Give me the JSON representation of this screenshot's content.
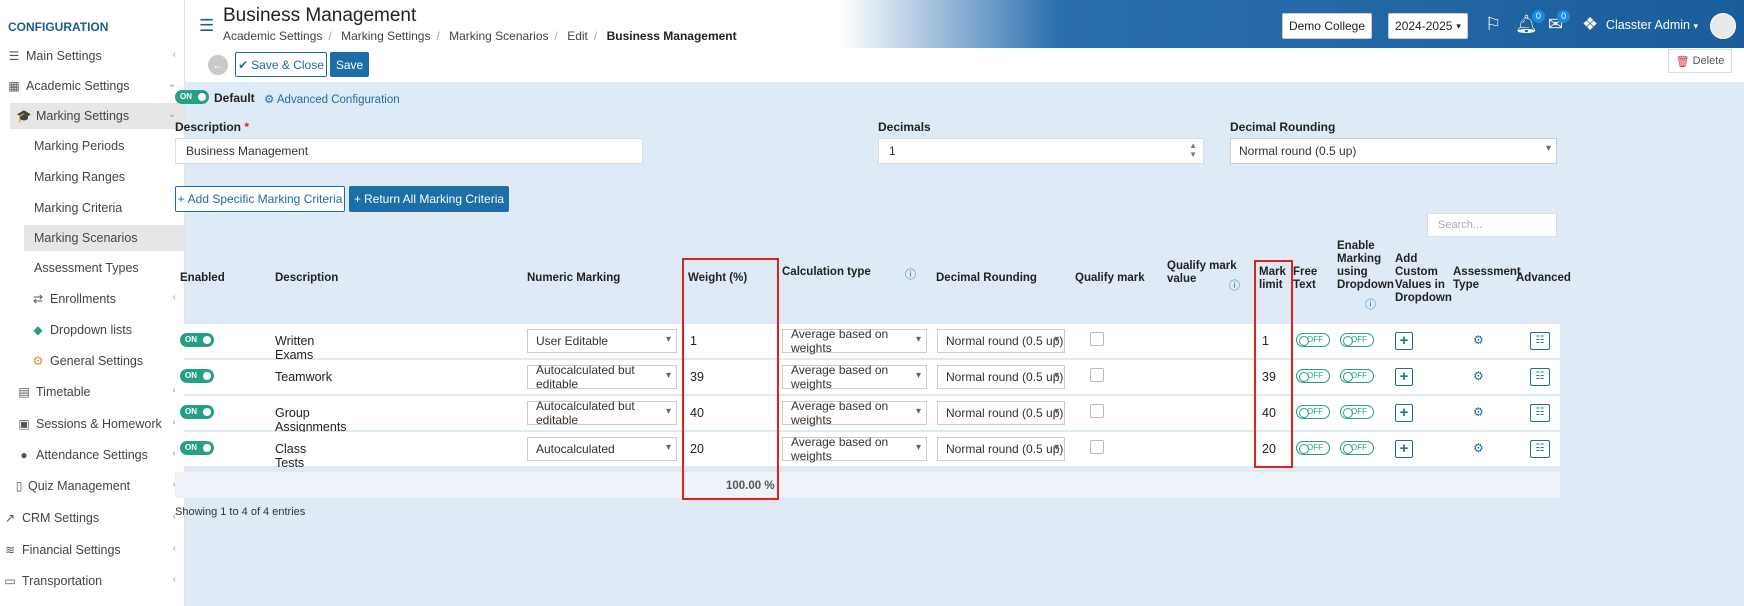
{
  "sidebar": {
    "title": "CONFIGURATION",
    "items": [
      {
        "label": "Main Settings",
        "icon": "sliders-icon"
      },
      {
        "label": "Academic Settings",
        "icon": "school-icon"
      },
      {
        "label": "Marking Settings",
        "icon": "graduation-cap-icon"
      },
      {
        "label": "Marking Periods"
      },
      {
        "label": "Marking Ranges"
      },
      {
        "label": "Marking Criteria"
      },
      {
        "label": "Marking Scenarios"
      },
      {
        "label": "Assessment Types"
      },
      {
        "label": "Enrollments",
        "icon": "arrows-icon"
      },
      {
        "label": "Dropdown lists",
        "icon": "layers-icon"
      },
      {
        "label": "General Settings",
        "icon": "gears-icon"
      },
      {
        "label": "Timetable",
        "icon": "calendar-icon"
      },
      {
        "label": "Sessions & Homework",
        "icon": "sessions-icon"
      },
      {
        "label": "Attendance Settings",
        "icon": "user-check-icon"
      },
      {
        "label": "Quiz Management",
        "icon": "book-icon"
      },
      {
        "label": "CRM Settings",
        "icon": "chart-icon"
      },
      {
        "label": "Financial Settings",
        "icon": "coins-icon"
      },
      {
        "label": "Transportation",
        "icon": "bus-icon"
      }
    ]
  },
  "header": {
    "title": "Business Management",
    "breadcrumb": [
      "Academic Settings",
      "Marking Settings",
      "Marking Scenarios",
      "Edit",
      "Business Management"
    ],
    "college": "Demo College",
    "year": "2024-2025",
    "notifications_count": "0",
    "messages_count": "0",
    "user": "Classter Admin"
  },
  "actions": {
    "save_close": "Save & Close",
    "save": "Save",
    "delete": "Delete"
  },
  "form": {
    "default_toggle": "ON",
    "default_label": "Default",
    "advanced_config": "Advanced Configuration",
    "description_label": "Description",
    "required_mark": "*",
    "description_value": "Business Management",
    "decimals_label": "Decimals",
    "decimals_value": "1",
    "decimal_rounding_label": "Decimal Rounding",
    "decimal_rounding_value": "Normal round (0.5 up)",
    "add_specific": "Add Specific Marking Criteria",
    "return_all": "Return All Marking Criteria",
    "search_placeholder": "Search..."
  },
  "table": {
    "headers": {
      "enabled": "Enabled",
      "description": "Description",
      "numeric_marking": "Numeric Marking",
      "weight": "Weight (%)",
      "calculation_type": "Calculation type",
      "decimal_rounding": "Decimal Rounding",
      "qualify_mark": "Qualify mark",
      "qualify_mark_value_1": "Qualify mark",
      "qualify_mark_value_2": "value",
      "mark_limit_1": "Mark",
      "mark_limit_2": "limit",
      "free_text_1": "Free",
      "free_text_2": "Text",
      "enable_dropdown": [
        "Enable",
        "Marking",
        "using",
        "Dropdown"
      ],
      "add_custom": [
        "Add",
        "Custom",
        "Values in",
        "Dropdown"
      ],
      "assessment_type_1": "Assessment",
      "assessment_type_2": "Type",
      "advanced": "Advanced"
    },
    "rows": [
      {
        "enabled": "ON",
        "description": "Written Exams",
        "numeric": "User Editable",
        "weight": "1",
        "calc": "Average based on weights",
        "rounding": "Normal round (0.5 up)",
        "limit": "1",
        "free": "OFF",
        "dropdown": "OFF"
      },
      {
        "enabled": "ON",
        "description": "Teamwork",
        "numeric": "Autocalculated but editable",
        "weight": "39",
        "calc": "Average based on weights",
        "rounding": "Normal round (0.5 up)",
        "limit": "39",
        "free": "OFF",
        "dropdown": "OFF"
      },
      {
        "enabled": "ON",
        "description": "Group Assignments",
        "numeric": "Autocalculated but editable",
        "weight": "40",
        "calc": "Average based on weights",
        "rounding": "Normal round (0.5 up)",
        "limit": "40",
        "free": "OFF",
        "dropdown": "OFF"
      },
      {
        "enabled": "ON",
        "description": "Class Tests",
        "numeric": "Autocalculated",
        "weight": "20",
        "calc": "Average based on weights",
        "rounding": "Normal round (0.5 up)",
        "limit": "20",
        "free": "OFF",
        "dropdown": "OFF"
      }
    ],
    "total_weight": "100.00 %",
    "footer": "Showing 1 to 4 of 4 entries"
  }
}
